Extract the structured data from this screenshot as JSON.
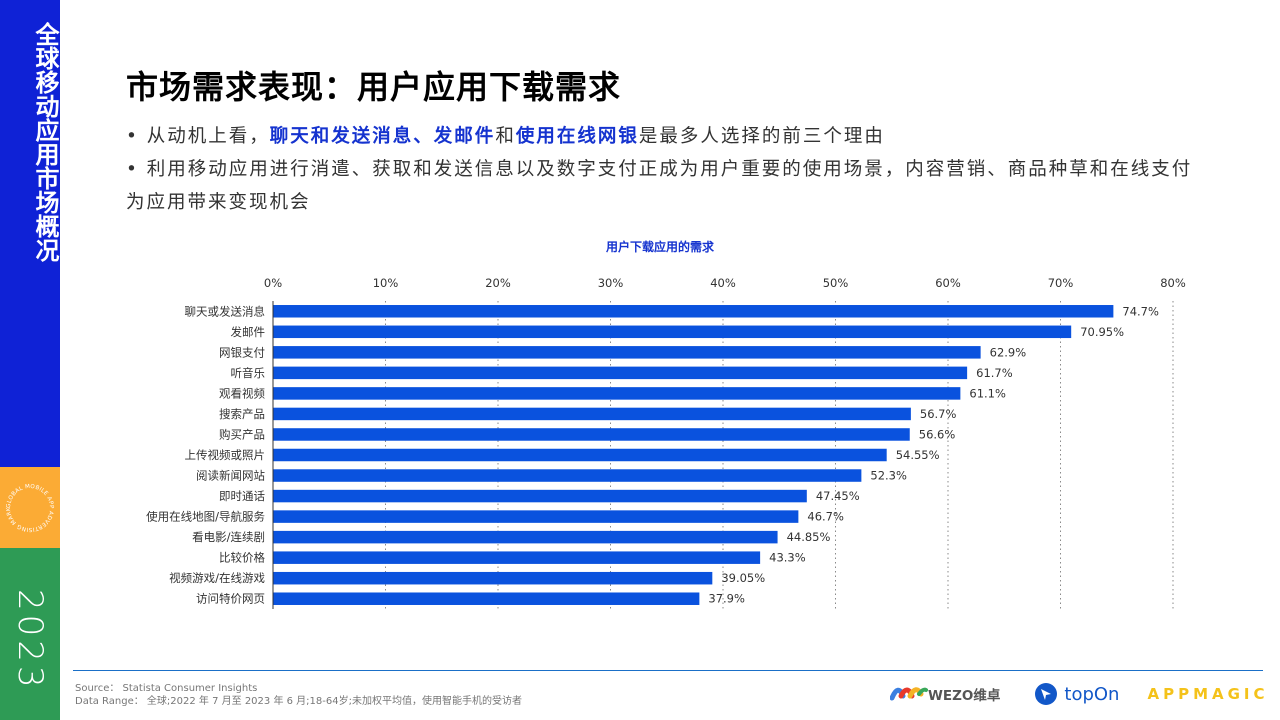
{
  "sidebar": {
    "title": "全球移动应用市场概况",
    "badge_text": "GLOBAL MOBILE APP ADVERTISING MARKETING",
    "year": "2023"
  },
  "header": {
    "title": "市场需求表现：用户应用下载需求"
  },
  "bullets": [
    {
      "segments": [
        {
          "text": "• 从动机上看，",
          "highlight": false
        },
        {
          "text": "聊天和发送消息、发邮件",
          "highlight": true
        },
        {
          "text": "和",
          "highlight": false
        },
        {
          "text": "使用在线网银",
          "highlight": true
        },
        {
          "text": "是最多人选择的前三个理由",
          "highlight": false
        }
      ]
    },
    {
      "segments": [
        {
          "text": "• 利用移动应用进行消遣、获取和发送信息以及数字支付正成为用户重要的使用场景，内容营销、商品种草和在线支付为应用带来变现机会",
          "highlight": false
        }
      ]
    }
  ],
  "colors": {
    "sidebar_blue": "#0f22d6",
    "sidebar_orange": "#fbab35",
    "sidebar_green": "#2e9b55",
    "bar": "#0a52de",
    "highlight": "#1533cf",
    "footer_line": "#1a6fc7"
  },
  "chart_data": {
    "type": "bar",
    "orientation": "horizontal",
    "title": "用户下载应用的需求",
    "xlabel": "",
    "ylabel": "",
    "xlim": [
      0,
      80
    ],
    "x_ticks": [
      "0%",
      "10%",
      "20%",
      "30%",
      "40%",
      "50%",
      "60%",
      "70%",
      "80%"
    ],
    "x_tick_values": [
      0,
      10,
      20,
      30,
      40,
      50,
      60,
      70,
      80
    ],
    "grid": "vertical dotted",
    "axis_position": "top",
    "categories": [
      "聊天或发送消息",
      "发邮件",
      "网银支付",
      "听音乐",
      "观看视频",
      "搜索产品",
      "购买产品",
      "上传视频或照片",
      "阅读新闻网站",
      "即时通话",
      "使用在线地图/导航服务",
      "看电影/连续剧",
      "比较价格",
      "视频游戏/在线游戏",
      "访问特价网页"
    ],
    "values": [
      74.7,
      70.95,
      62.9,
      61.7,
      61.1,
      56.7,
      56.6,
      54.55,
      52.3,
      47.45,
      46.7,
      44.85,
      43.3,
      39.05,
      37.9
    ],
    "value_labels": [
      "74.7%",
      "70.95%",
      "62.9%",
      "61.7%",
      "61.1%",
      "56.7%",
      "56.6%",
      "54.55%",
      "52.3%",
      "47.45%",
      "46.7%",
      "44.85%",
      "43.3%",
      "39.05%",
      "37.9%"
    ]
  },
  "footer": {
    "source": "Source： Statista Consumer Insights",
    "data_range": "Data Range： 全球;2022 年 7 月至 2023 年 6 月;18-64岁;未加权平均值，使用智能手机的受访者",
    "logos": {
      "wezo": "WEZO维卓",
      "topon": "topOn",
      "appmagic": "APPMAGIC"
    }
  }
}
